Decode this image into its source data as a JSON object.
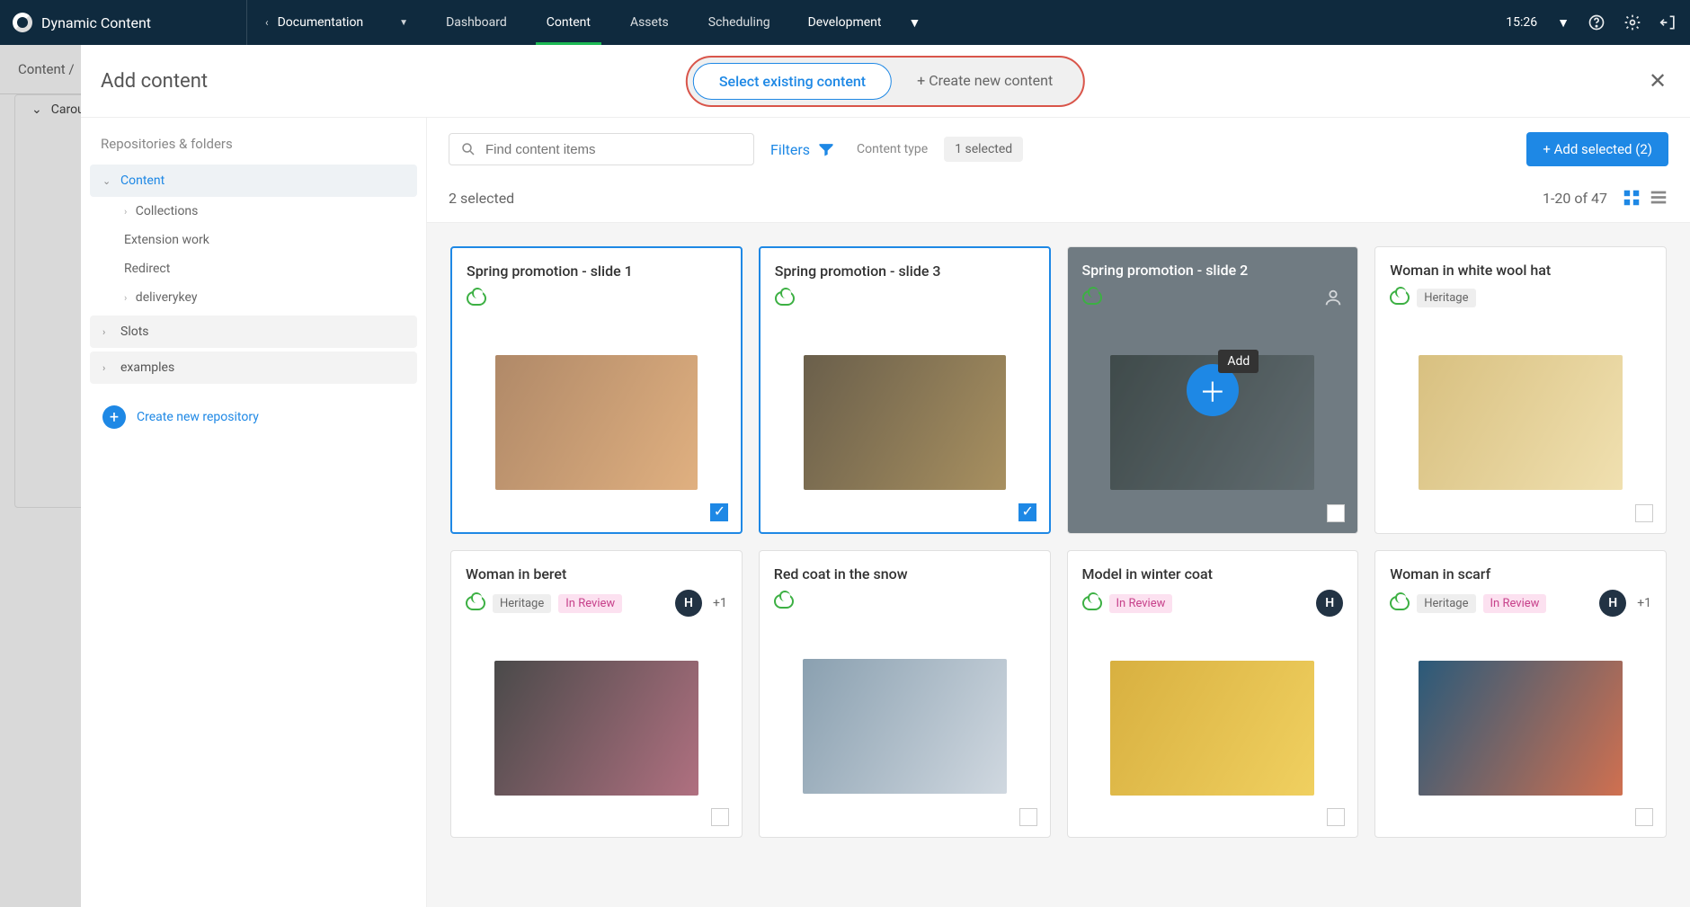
{
  "topnav": {
    "brand": "Dynamic Content",
    "doc_label": "Documentation",
    "tabs": [
      "Dashboard",
      "Content",
      "Assets",
      "Scheduling"
    ],
    "active_tab": "Content",
    "env": "Development",
    "time": "15:26"
  },
  "subbar": {
    "crumb": "Content  /"
  },
  "bg_panel": {
    "item": "Carousel"
  },
  "modal": {
    "title": "Add content",
    "seg_existing": "Select existing content",
    "seg_new": "+ Create new content",
    "side": {
      "heading": "Repositories & folders",
      "content": "Content",
      "collections": "Collections",
      "ext_work": "Extension work",
      "redirect": "Redirect",
      "deliverykey": "deliverykey",
      "slots": "Slots",
      "examples": "examples",
      "new_repo": "Create new repository"
    },
    "toolbar": {
      "search_placeholder": "Find content items",
      "filters": "Filters",
      "content_type_label": "Content type",
      "content_type_chip": "1 selected",
      "add_selected": "+ Add selected (2)"
    },
    "status": {
      "selected": "2 selected",
      "range": "1-20 of 47"
    },
    "hover": {
      "tooltip": "Add"
    },
    "cards": [
      {
        "title": "Spring promotion - slide 1",
        "tags": [],
        "selected": true,
        "ph": "ph1"
      },
      {
        "title": "Spring promotion - slide 3",
        "tags": [],
        "selected": true,
        "ph": "ph2"
      },
      {
        "title": "Spring promotion - slide 2",
        "tags": [],
        "hover": true,
        "ph": "ph3",
        "person_icon": true
      },
      {
        "title": "Woman in white wool hat",
        "tags": [
          "Heritage"
        ],
        "ph": "ph4"
      },
      {
        "title": "Woman in beret",
        "tags": [
          "Heritage",
          "In Review"
        ],
        "avatar": "H",
        "more": "+1",
        "ph": "ph5"
      },
      {
        "title": "Red coat in the snow",
        "tags": [],
        "ph": "ph6"
      },
      {
        "title": "Model in winter coat",
        "tags": [
          "In Review"
        ],
        "avatar": "H",
        "ph": "ph7"
      },
      {
        "title": "Woman in scarf",
        "tags": [
          "Heritage",
          "In Review"
        ],
        "avatar": "H",
        "more": "+1",
        "ph": "ph8"
      }
    ]
  }
}
